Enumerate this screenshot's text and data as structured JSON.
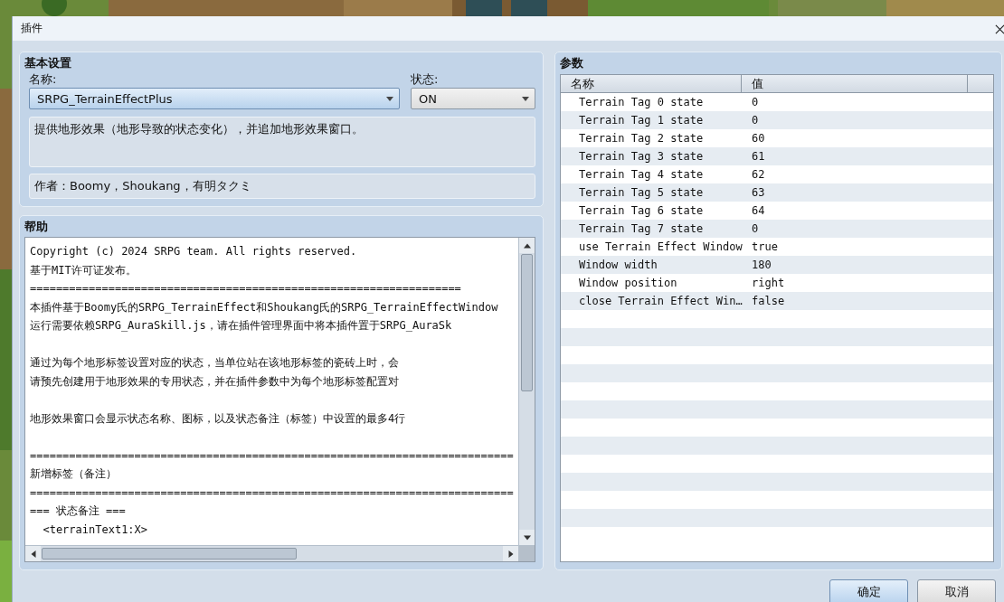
{
  "window": {
    "title": "插件"
  },
  "basic_settings": {
    "title": "基本设置",
    "name_label": "名称:",
    "name_value": "SRPG_TerrainEffectPlus",
    "name_focused": true,
    "status_label": "状态:",
    "status_value": "ON",
    "description": "提供地形效果（地形导致的状态变化），并追加地形效果窗口。",
    "author": "作者：Boomy，Shoukang，有明タクミ"
  },
  "help": {
    "title": "帮助",
    "paragraphs": [
      [
        "Copyright (c) 2024 SRPG team. All rights reserved.",
        "基于MIT许可证发布。",
        "==================================================================",
        "本插件基于Boomy氏的SRPG_TerrainEffect和Shoukang氏的SRPG_TerrainEffectWindow",
        "运行需要依赖SRPG_AuraSkill.js，请在插件管理界面中将本插件置于SRPG_AuraSk"
      ],
      [
        "通过为每个地形标签设置对应的状态，当单位站在该地形标签的瓷砖上时，会",
        "请预先创建用于地形效果的专用状态，并在插件参数中为每个地形标签配置对"
      ],
      [
        "地形效果窗口会显示状态名称、图标，以及状态备注（标签）中设置的最多4行"
      ],
      [
        "==========================================================================",
        "新增标签（备注）",
        "==========================================================================",
        "=== 状态备注 ===",
        "  <terrainText1:X>"
      ]
    ]
  },
  "parameters": {
    "title": "参数",
    "columns": [
      "名称",
      "值"
    ],
    "rows": [
      {
        "name": "Terrain Tag 0 state",
        "value": "0"
      },
      {
        "name": "Terrain Tag 1 state",
        "value": "0"
      },
      {
        "name": "Terrain Tag 2 state",
        "value": "60"
      },
      {
        "name": "Terrain Tag 3 state",
        "value": "61"
      },
      {
        "name": "Terrain Tag 4 state",
        "value": "62"
      },
      {
        "name": "Terrain Tag 5 state",
        "value": "63"
      },
      {
        "name": "Terrain Tag 6 state",
        "value": "64"
      },
      {
        "name": "Terrain Tag 7 state",
        "value": "0"
      },
      {
        "name": "use Terrain Effect Window",
        "value": "true"
      },
      {
        "name": "Window width",
        "value": "180"
      },
      {
        "name": "Window position",
        "value": "right"
      },
      {
        "name": "close Terrain Effect Win…",
        "value": "false"
      }
    ]
  },
  "buttons": [
    {
      "label": "确定",
      "default": true
    },
    {
      "label": "取消",
      "default": false
    }
  ]
}
